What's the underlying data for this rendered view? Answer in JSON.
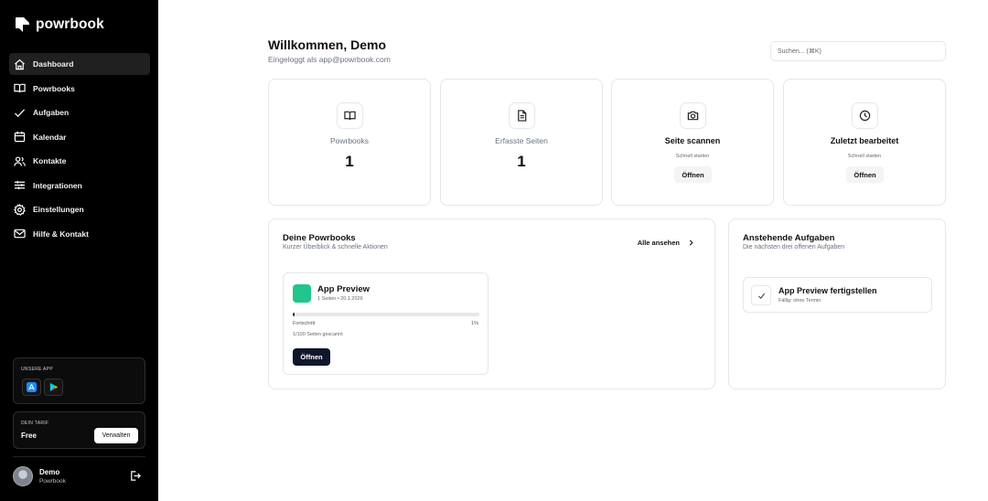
{
  "brand": {
    "name": "powrbook"
  },
  "sidebar": {
    "items": [
      {
        "label": "Dashboard",
        "icon": "home-icon",
        "active": true
      },
      {
        "label": "Powrbooks",
        "icon": "book-icon"
      },
      {
        "label": "Aufgaben",
        "icon": "check-icon"
      },
      {
        "label": "Kalendar",
        "icon": "calendar-icon"
      },
      {
        "label": "Kontakte",
        "icon": "users-icon"
      },
      {
        "label": "Integrationen",
        "icon": "sliders-icon"
      },
      {
        "label": "Einstellungen",
        "icon": "gear-icon"
      },
      {
        "label": "Hilfe & Kontakt",
        "icon": "mail-icon"
      }
    ],
    "app_caption": "UNSERE APP",
    "tarif_caption": "DEIN TARIF",
    "tarif_plan": "Free",
    "manage_label": "Verwalten",
    "user": {
      "name": "Demo",
      "org": "Powrbook"
    }
  },
  "header": {
    "title": "Willkommen, Demo",
    "subtitle": "Eingeloggt als app@powrbook.com",
    "search_placeholder": "Suchen... (⌘K)"
  },
  "stats": [
    {
      "label": "Powrbooks",
      "value": "1",
      "icon": "book-open-icon"
    },
    {
      "label": "Erfasste Seiten",
      "value": "1",
      "icon": "file-text-icon"
    }
  ],
  "actions": [
    {
      "label": "Seite scannen",
      "hint": "Schnell starten",
      "button": "Öffnen",
      "icon": "camera-icon"
    },
    {
      "label": "Zuletzt bearbeitet",
      "hint": "Schnell starten",
      "button": "Öffnen",
      "icon": "clock-icon"
    }
  ],
  "powrbooks_panel": {
    "title": "Deine Powrbooks",
    "subtitle": "Kurzer Überblick & schnelle Aktionen",
    "all_link": "Alle ansehen",
    "book": {
      "title": "App Preview",
      "meta": "1 Seiten • 20.1.2026",
      "progress_label": "Fortschritt",
      "progress_percent": "1%",
      "progress_value": 1,
      "pages_scanned": "1/100 Seiten gescannt",
      "open_label": "Öffnen",
      "color": "#22c58b"
    }
  },
  "tasks_panel": {
    "title": "Anstehende Aufgaben",
    "subtitle": "Die nächsten drei offenen Aufgaben",
    "task": {
      "title": "App Preview fertigstellen",
      "due": "Fällig: ohne Termin"
    }
  }
}
